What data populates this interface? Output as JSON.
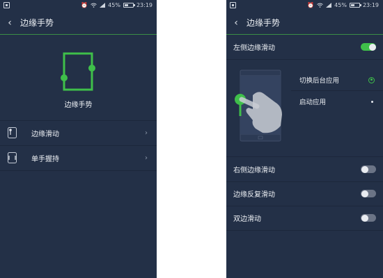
{
  "status_bar": {
    "battery_percent": "45%",
    "time": "23:19",
    "battery_level": 0.45,
    "icons": [
      "notification-icon",
      "alarm-icon",
      "wifi-icon",
      "signal-icon",
      "battery-icon"
    ]
  },
  "left_screen": {
    "title": "边缘手势",
    "hero_label": "边缘手势",
    "menu": [
      {
        "label": "边缘滑动",
        "icon": "phone-edge-swipe-icon"
      },
      {
        "label": "单手握持",
        "icon": "phone-one-hand-icon"
      }
    ]
  },
  "right_screen": {
    "title": "边缘手势",
    "left_edge_slide": {
      "label": "左侧边缘滑动",
      "enabled": true
    },
    "options": [
      {
        "label": "切换后台应用",
        "selected": true
      },
      {
        "label": "启动应用",
        "selected": false
      }
    ],
    "settings": [
      {
        "label": "右侧边缘滑动",
        "enabled": false
      },
      {
        "label": "边缘反复滑动",
        "enabled": false
      },
      {
        "label": "双边滑动",
        "enabled": false
      }
    ]
  },
  "colors": {
    "background": "#233047",
    "accent": "#3fbf4a",
    "divider": "#1c273b"
  }
}
